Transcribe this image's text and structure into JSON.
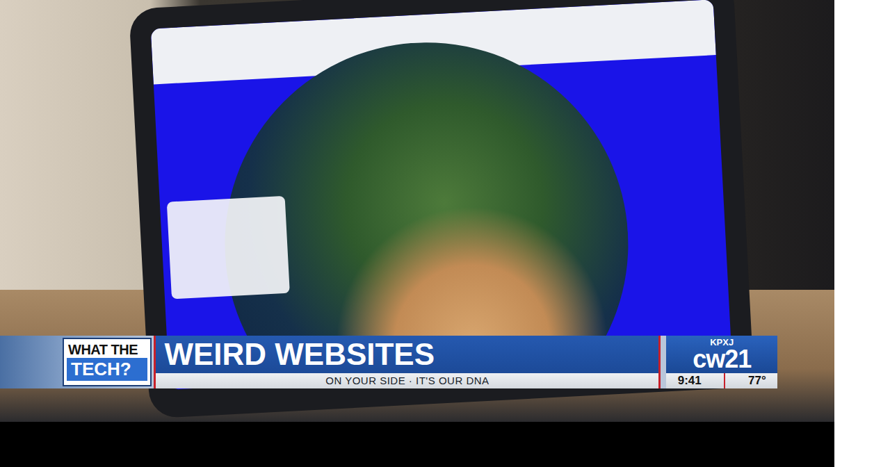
{
  "banner": {
    "show_logo": {
      "line1": "WHAT THE",
      "line2": "TECH?"
    },
    "headline": "WEIRD WEBSITES",
    "tagline": "ON YOUR SIDE · IT'S OUR DNA"
  },
  "station": {
    "callsign": "KPXJ",
    "logo": "cw21",
    "time": "9:41",
    "temperature": "77°"
  }
}
